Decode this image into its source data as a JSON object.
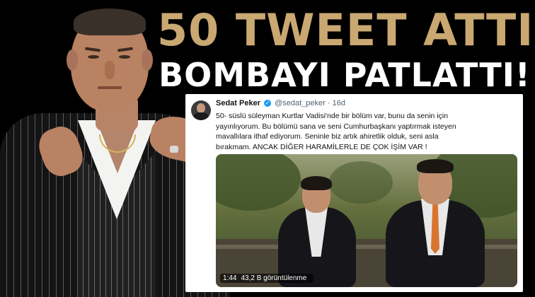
{
  "headline": {
    "line1": "50 TWEET ATTI",
    "line2": "BOMBAYI PATLATTI!"
  },
  "tweet": {
    "name": "Sedat Peker",
    "handle": "@sedat_peker",
    "separator": "·",
    "time": "16d",
    "verified_icon": "verified-badge-icon",
    "text_lines": [
      "50- süslü süleyman Kurtlar Vadisi'nde bir bölüm var, bunu da senin için",
      "yayınlıyorum. Bu bölümü sana ve seni Cumhurbaşkanı yaptırmak isteyen",
      "mavallılara ithaf ediyorum. Seninle biz artık ahiretlik olduk, seni asla",
      "bırakmam. ANCAK DİĞER HARAMİLERLE DE ÇOK İŞİM VAR !"
    ],
    "video": {
      "duration": "1:44",
      "views": "43,2 B görüntülenme"
    }
  },
  "colors": {
    "headline_gold": "#c9a871",
    "headline_white": "#ffffff",
    "background": "#000000",
    "verified_blue": "#1d9bf0"
  }
}
